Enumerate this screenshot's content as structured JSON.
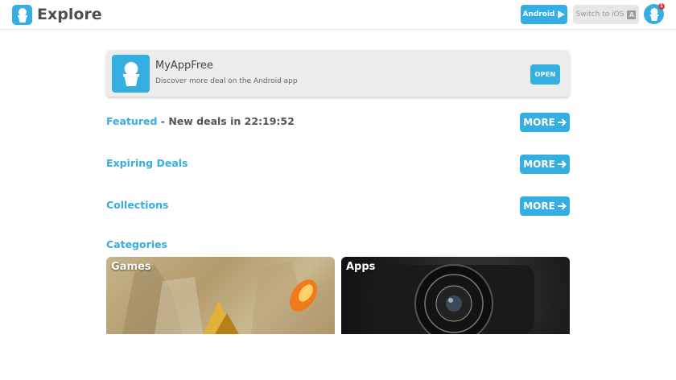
{
  "header": {
    "title": "Explore",
    "android_label": "Android",
    "ios_label": "Switch to iOS",
    "ios_glyph": "A",
    "notification_count": "1",
    "accent_color": "#35aee1"
  },
  "promo": {
    "app_name": "MyAppFree",
    "description": "Discover more deal on the Android app",
    "open_label": "OPEN"
  },
  "sections": {
    "featured": {
      "title": "Featured",
      "subtitle": " - New deals in 22:19:52",
      "more_label": "MORE"
    },
    "expiring": {
      "title": "Expiring Deals",
      "more_label": "MORE"
    },
    "collections": {
      "title": "Collections",
      "more_label": "MORE"
    }
  },
  "categories": {
    "title": "Categories",
    "items": [
      {
        "label": "Games"
      },
      {
        "label": "Apps"
      }
    ]
  },
  "icons": {
    "logo": "ice-cream-icon",
    "android": "play-store-icon",
    "ios": "app-store-icon",
    "more": "arrow-right-icon"
  }
}
